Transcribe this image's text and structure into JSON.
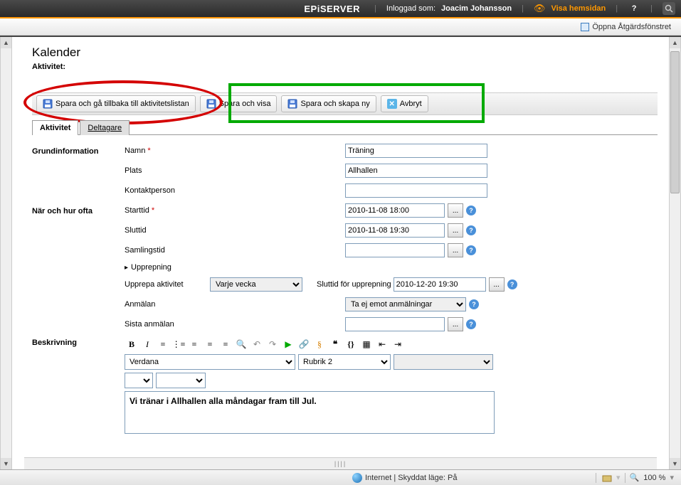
{
  "topbar": {
    "logo": "EPiSERVER",
    "logged_in_as_label": "Inloggad som:",
    "user": "Joacim Johansson",
    "view_site": "Visa hemsidan",
    "help": "?",
    "action_window": "Öppna Åtgärdsfönstret"
  },
  "page": {
    "title": "Kalender",
    "subtitle": "Aktivitet:"
  },
  "toolbar": {
    "save_back": "Spara och gå tillbaka till aktivitetslistan",
    "save_view": "Spara och visa",
    "save_new": "Spara och skapa ny",
    "cancel": "Avbryt"
  },
  "tabs": {
    "activity": "Aktivitet",
    "participants": "Deltagare"
  },
  "sections": {
    "basic": "Grundinformation",
    "when": "När och hur ofta",
    "desc": "Beskrivning"
  },
  "labels": {
    "name": "Namn",
    "place": "Plats",
    "contact": "Kontaktperson",
    "start": "Starttid",
    "end": "Sluttid",
    "gather": "Samlingstid",
    "repeat_hdr": "Upprepning",
    "repeat_act": "Upprepa aktivitet",
    "repeat_end": "Sluttid för upprepning",
    "signup": "Anmälan",
    "last_signup": "Sista anmälan"
  },
  "values": {
    "name": "Träning",
    "place": "Allhallen",
    "contact": "",
    "start": "2010-11-08 18:00",
    "end": "2010-11-08 19:30",
    "gather": "",
    "repeat_sel": "Varje vecka",
    "repeat_end": "2010-12-20 19:30",
    "signup_sel": "Ta ej emot anmälningar",
    "last_signup": ""
  },
  "rte": {
    "font": "Verdana",
    "style": "Rubrik 2",
    "content": "Vi tränar i Allhallen alla måndagar fram till Jul."
  },
  "status": {
    "zone": "Internet | Skyddat läge: På",
    "zoom": "100 %"
  },
  "picker_btn": "..."
}
